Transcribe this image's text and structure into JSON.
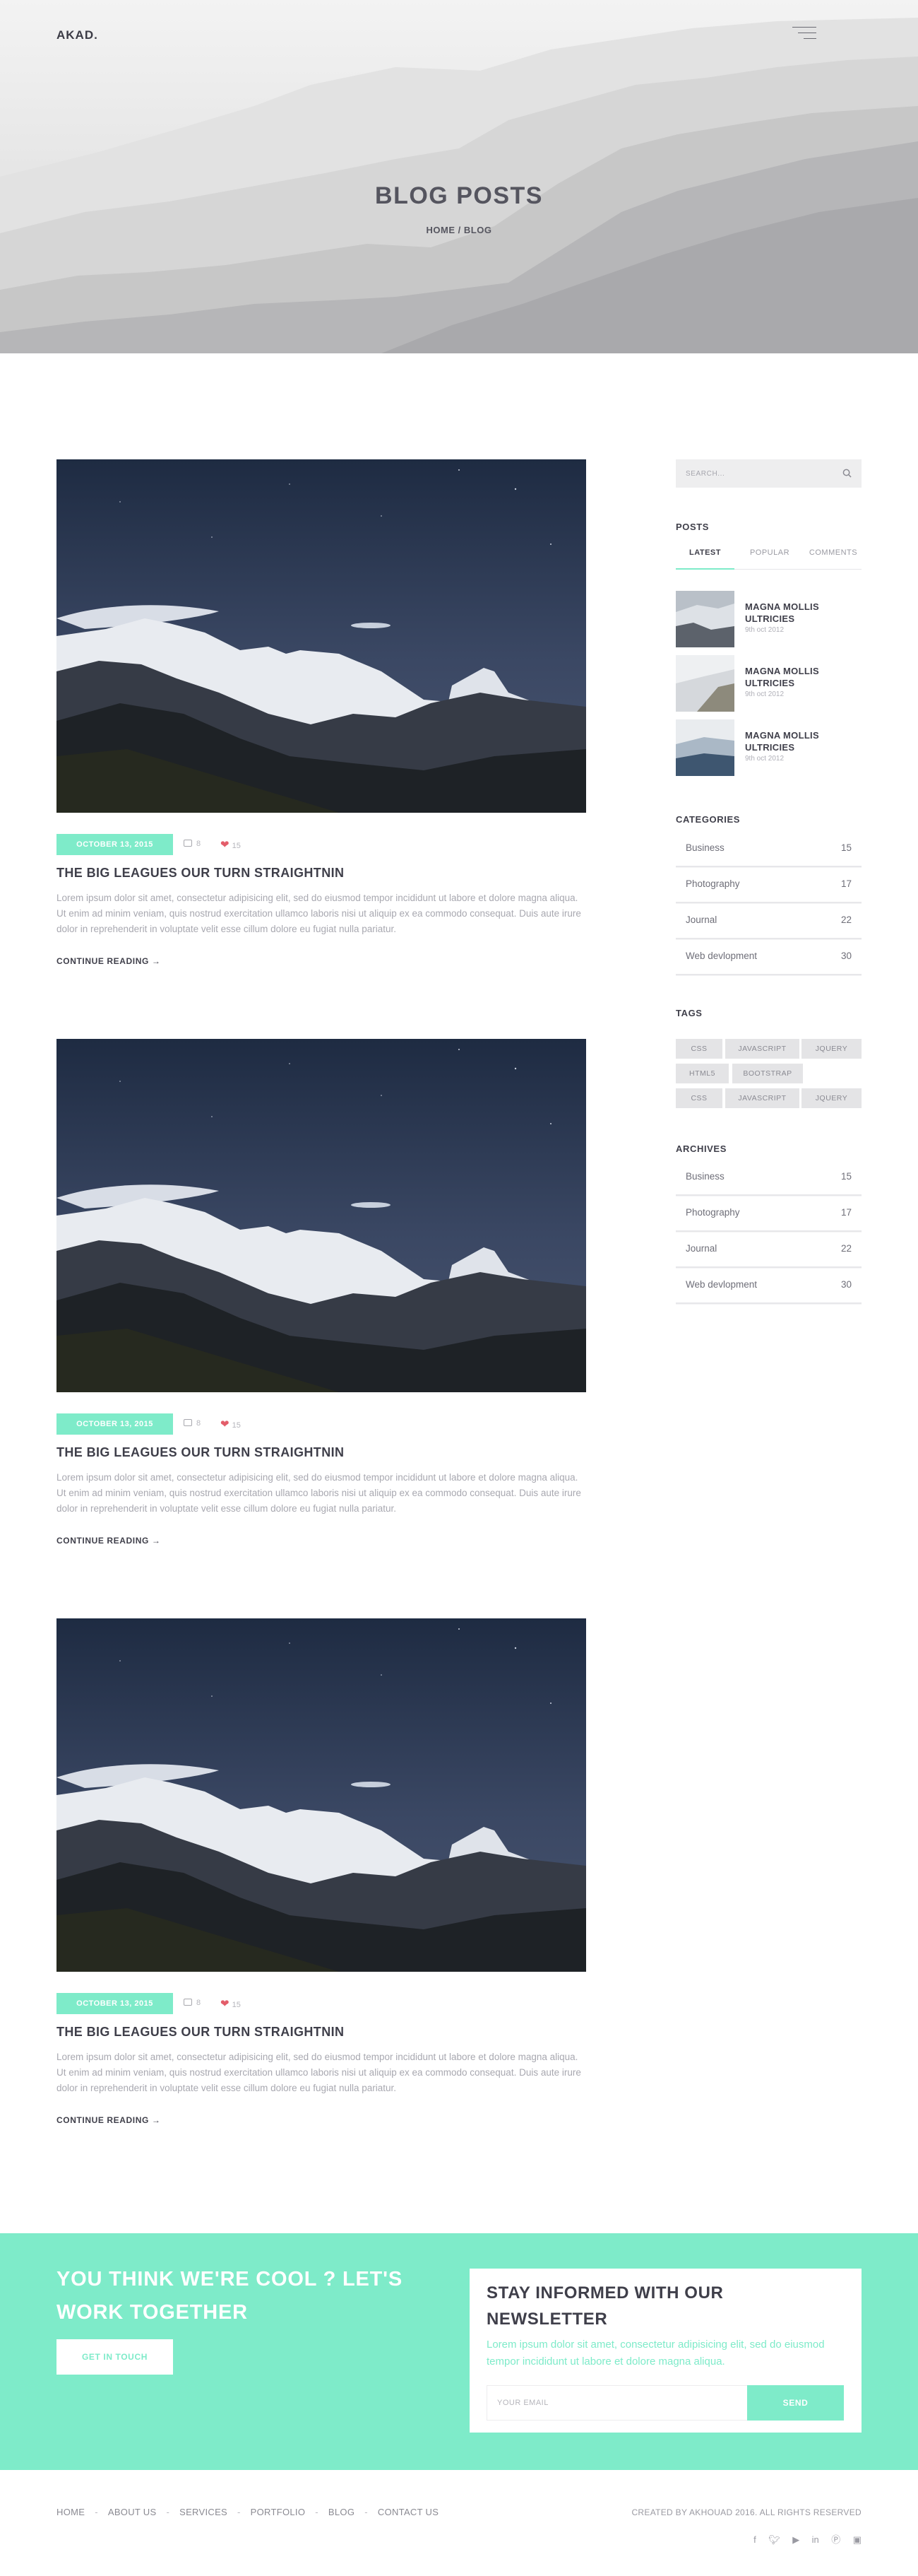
{
  "header": {
    "logo": "AKAD.",
    "title": "BLOG POSTS",
    "breadcrumb": "HOME / BLOG"
  },
  "posts": [
    {
      "date": "OCTOBER 13, 2015",
      "comments": "8",
      "likes": "15",
      "title": "THE BIG LEAGUES OUR TURN STRAIGHTNIN",
      "excerpt": "Lorem ipsum dolor sit amet, consectetur adipisicing elit, sed do eiusmod tempor incididunt ut labore et dolore magna aliqua. Ut enim ad minim veniam, quis nostrud exercitation ullamco laboris nisi ut aliquip ex ea commodo consequat. Duis aute irure dolor in reprehenderit in voluptate velit esse cillum dolore eu fugiat nulla pariatur.",
      "read_more": "CONTINUE READING →"
    },
    {
      "date": "OCTOBER 13, 2015",
      "comments": "8",
      "likes": "15",
      "title": "THE BIG LEAGUES OUR TURN STRAIGHTNIN",
      "excerpt": "Lorem ipsum dolor sit amet, consectetur adipisicing elit, sed do eiusmod tempor incididunt ut labore et dolore magna aliqua. Ut enim ad minim veniam, quis nostrud exercitation ullamco laboris nisi ut aliquip ex ea commodo consequat. Duis aute irure dolor in reprehenderit in voluptate velit esse cillum dolore eu fugiat nulla pariatur.",
      "read_more": "CONTINUE READING →"
    },
    {
      "date": "OCTOBER 13, 2015",
      "comments": "8",
      "likes": "15",
      "title": "THE BIG LEAGUES OUR TURN STRAIGHTNIN",
      "excerpt": "Lorem ipsum dolor sit amet, consectetur adipisicing elit, sed do eiusmod tempor incididunt ut labore et dolore magna aliqua. Ut enim ad minim veniam, quis nostrud exercitation ullamco laboris nisi ut aliquip ex ea commodo consequat. Duis aute irure dolor in reprehenderit in voluptate velit esse cillum dolore eu fugiat nulla pariatur.",
      "read_more": "CONTINUE READING →"
    }
  ],
  "sidebar": {
    "search_placeholder": "SEARCH...",
    "posts_title": "POSTS",
    "tabs": [
      "LATEST",
      "POPULAR",
      "COMMENTS"
    ],
    "recent": [
      {
        "title": "MAGNA MOLLIS ULTRICIES",
        "date": "9th oct 2012"
      },
      {
        "title": "MAGNA MOLLIS ULTRICIES",
        "date": "9th oct 2012"
      },
      {
        "title": "MAGNA MOLLIS ULTRICIES",
        "date": "9th oct 2012"
      }
    ],
    "categories_title": "CATEGORIES",
    "categories": [
      {
        "name": "Business",
        "count": "15"
      },
      {
        "name": "Photography",
        "count": "17"
      },
      {
        "name": "Journal",
        "count": "22"
      },
      {
        "name": "Web devlopment",
        "count": "30"
      }
    ],
    "tags_title": "TAGS",
    "tags": [
      "CSS",
      "JAVASCRIPT",
      "JQUERY",
      "HTML5",
      "BOOTSTRAP",
      "CSS",
      "JAVASCRIPT",
      "JQUERY"
    ],
    "archives_title": "ARCHIVES",
    "archives": [
      {
        "name": "Business",
        "count": "15"
      },
      {
        "name": "Photography",
        "count": "17"
      },
      {
        "name": "Journal",
        "count": "22"
      },
      {
        "name": "Web devlopment",
        "count": "30"
      }
    ]
  },
  "cta": {
    "title": "YOU THINK WE'RE COOL ? LET'S WORK TOGETHER",
    "button": "GET IN TOUCH"
  },
  "newsletter": {
    "title": "STAY INFORMED WITH OUR NEWSLETTER",
    "text": "Lorem ipsum dolor sit amet, consectetur adipisicing elit, sed do eiusmod tempor incididunt ut labore et dolore magna aliqua.",
    "placeholder": "YOUR EMAIL",
    "button": "SEND"
  },
  "footer": {
    "nav": [
      "HOME",
      "ABOUT US",
      "SERVICES",
      "PORTFOLIO",
      "BLOG",
      "CONTACT US"
    ],
    "separator": "-",
    "copyright": "CREATED BY AKHOUAD 2016. ALL RIGHTS RESERVED",
    "social": [
      "facebook-icon",
      "twitter-icon",
      "youtube-icon",
      "linkedin-icon",
      "pinterest-icon",
      "instagram-icon"
    ]
  },
  "colors": {
    "accent": "#7eebc9",
    "heart": "#e35d6a",
    "text_dark": "#3f3f4a"
  }
}
